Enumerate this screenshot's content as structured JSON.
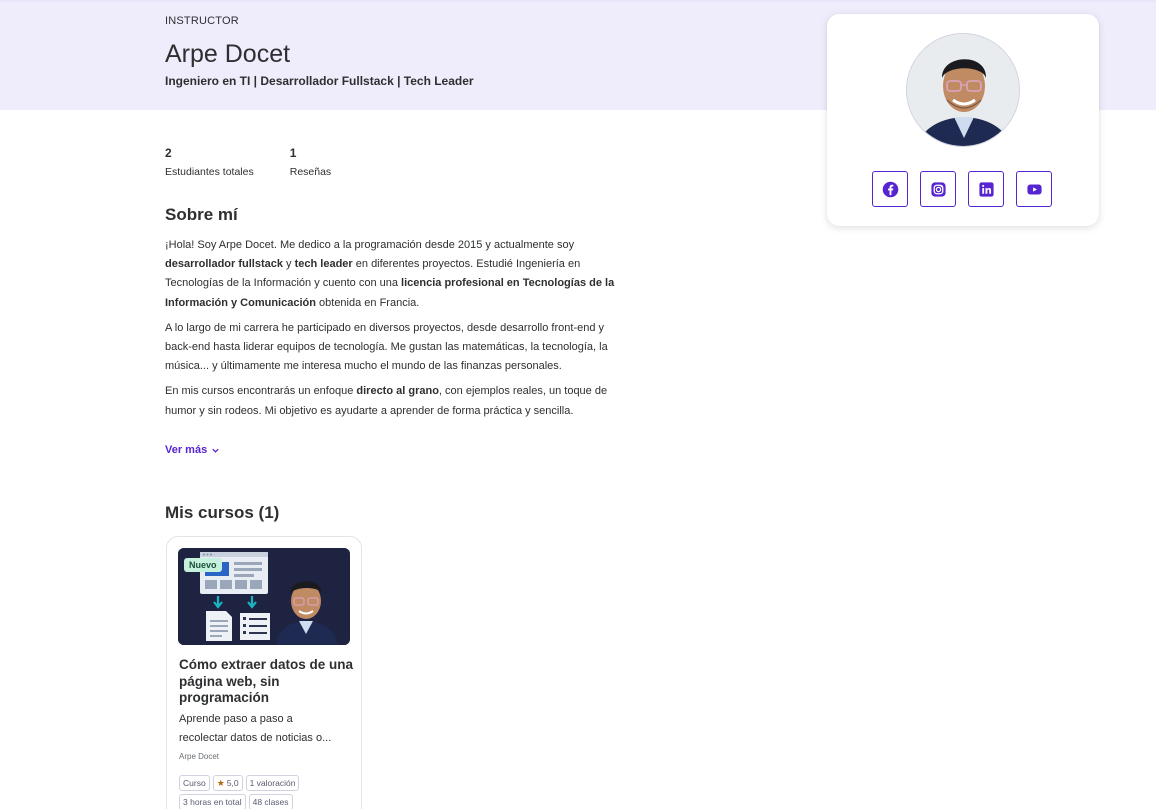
{
  "header": {
    "eyebrow": "INSTRUCTOR",
    "name": "Arpe Docet",
    "headline": "Ingeniero en TI | Desarrollador Fullstack | Tech Leader"
  },
  "stats": [
    {
      "value": "2",
      "label": "Estudiantes totales"
    },
    {
      "value": "1",
      "label": "Reseñas"
    }
  ],
  "about": {
    "title": "Sobre mí",
    "p1_a": "¡Hola! Soy Arpe Docet. Me dedico a la programación desde 2015 y actualmente soy ",
    "p1_b": "desarrollador fullstack",
    "p1_c": " y ",
    "p1_d": "tech leader",
    "p1_e": " en diferentes proyectos. Estudié Ingeniería en Tecnologías de la Información y cuento con una ",
    "p1_f": "licencia profesional en Tecnologías de la Información y Comunicación",
    "p1_g": " obtenida en Francia.",
    "p2": "A lo largo de mi carrera he participado en diversos proyectos, desde desarrollo front-end y back-end hasta liderar equipos de tecnología. Me gustan las matemáticas, la tecnología, la música... y últimamente me interesa mucho el mundo de las finanzas personales.",
    "p3_a": "En mis cursos encontrarás un enfoque ",
    "p3_b": "directo al grano",
    "p3_c": ", con ejemplos reales, un toque de humor y sin rodeos. Mi objetivo es ayudarte a aprender de forma práctica y sencilla.",
    "more_label": "Ver más"
  },
  "courses": {
    "title": "Mis cursos (1)",
    "items": [
      {
        "badge": "Nuevo",
        "title": "Cómo extraer datos de una página web, sin programación",
        "desc_line1": "Aprende paso a paso a",
        "desc_line2": "recolectar datos de noticias o...",
        "author": "Arpe Docet",
        "chips": {
          "type": "Curso",
          "rating": "5,0",
          "ratings_count": "1 valoración",
          "hours": "3 horas en total",
          "lectures": "48 clases"
        }
      }
    ]
  },
  "profile_card": {
    "socials": [
      {
        "name": "facebook",
        "icon": "facebook-icon"
      },
      {
        "name": "instagram",
        "icon": "instagram-icon"
      },
      {
        "name": "linkedin",
        "icon": "linkedin-icon"
      },
      {
        "name": "youtube",
        "icon": "youtube-icon"
      }
    ]
  },
  "colors": {
    "accent": "#5624d0",
    "hero_bg": "#efedfb",
    "text": "#2d2f31",
    "badge_new_bg": "#c6f1dc",
    "star": "#b4690e"
  }
}
